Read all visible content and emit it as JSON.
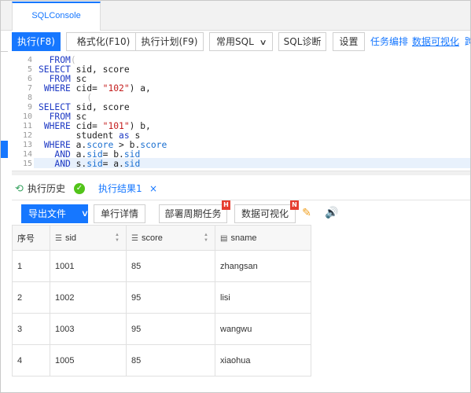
{
  "tabbar": {
    "active_tab": "SQLConsole"
  },
  "toolbar": {
    "execute": "执行(F8)",
    "format": "格式化(F10)",
    "plan": "执行计划(F9)",
    "common_sql": "常用SQL",
    "diagnose": "SQL诊断",
    "settings": "设置",
    "task_orchestration": "任务编排",
    "data_viz": "数据可视化",
    "cut_off": "跨"
  },
  "editor": {
    "line_numbers": [
      "4",
      "5",
      "6",
      "7",
      "8",
      "9",
      "10",
      "11",
      "12",
      "13",
      "14",
      "15"
    ],
    "lines": [
      {
        "p": [
          {
            "t": "  "
          },
          {
            "t": "FROM",
            "c": "kw"
          },
          {
            "t": "(",
            "c": "br"
          }
        ]
      },
      {
        "p": [
          {
            "t": "SELECT",
            "c": "kw"
          },
          {
            "t": " sid, score"
          }
        ]
      },
      {
        "p": [
          {
            "t": "  "
          },
          {
            "t": "FROM",
            "c": "kw"
          },
          {
            "t": " sc"
          }
        ]
      },
      {
        "p": [
          {
            "t": " "
          },
          {
            "t": "WHERE",
            "c": "kw"
          },
          {
            "t": " cid= "
          },
          {
            "t": "\"102\"",
            "c": "str"
          },
          {
            "t": ") a,"
          }
        ]
      },
      {
        "p": [
          {
            "t": "         "
          },
          {
            "t": "(",
            "c": "br"
          }
        ]
      },
      {
        "p": [
          {
            "t": "SELECT",
            "c": "kw"
          },
          {
            "t": " sid, score"
          }
        ]
      },
      {
        "p": [
          {
            "t": "  "
          },
          {
            "t": "FROM",
            "c": "kw"
          },
          {
            "t": " sc"
          }
        ]
      },
      {
        "p": [
          {
            "t": " "
          },
          {
            "t": "WHERE",
            "c": "kw"
          },
          {
            "t": " cid= "
          },
          {
            "t": "\"101\"",
            "c": "str"
          },
          {
            "t": ") b,"
          }
        ]
      },
      {
        "p": [
          {
            "t": "       student "
          },
          {
            "t": "as",
            "c": "kw"
          },
          {
            "t": " s"
          }
        ]
      },
      {
        "p": [
          {
            "t": " "
          },
          {
            "t": "WHERE",
            "c": "kw"
          },
          {
            "t": " a."
          },
          {
            "t": "score",
            "c": "fl"
          },
          {
            "t": " > b."
          },
          {
            "t": "score",
            "c": "fl"
          }
        ]
      },
      {
        "p": [
          {
            "t": "   "
          },
          {
            "t": "AND",
            "c": "kw"
          },
          {
            "t": " a."
          },
          {
            "t": "sid",
            "c": "fl"
          },
          {
            "t": "= b."
          },
          {
            "t": "sid",
            "c": "fl"
          }
        ]
      },
      {
        "p": [
          {
            "t": "   "
          },
          {
            "t": "AND",
            "c": "kw"
          },
          {
            "t": " s."
          },
          {
            "t": "sid",
            "c": "fl"
          },
          {
            "t": "= a."
          },
          {
            "t": "sid",
            "c": "fl"
          }
        ]
      }
    ]
  },
  "result_tabs": {
    "history": "执行历史",
    "result": "执行结果1",
    "close": "×"
  },
  "result_toolbar": {
    "export": "导出文件",
    "row_detail": "单行详情",
    "deploy_task": "部署周期任务",
    "deploy_badge": "H",
    "data_viz": "数据可视化",
    "viz_badge": "N"
  },
  "table": {
    "headers": [
      "序号",
      "sid",
      "score",
      "sname"
    ],
    "rows": [
      [
        "1",
        "1001",
        "85",
        "zhangsan"
      ],
      [
        "2",
        "1002",
        "95",
        "lisi"
      ],
      [
        "3",
        "1003",
        "95",
        "wangwu"
      ],
      [
        "4",
        "1005",
        "85",
        "xiaohua"
      ]
    ]
  },
  "colors": {
    "accent": "#1677ff",
    "badge": "#e53e30",
    "success": "#52c41a",
    "warning_icon": "#f0a020"
  }
}
